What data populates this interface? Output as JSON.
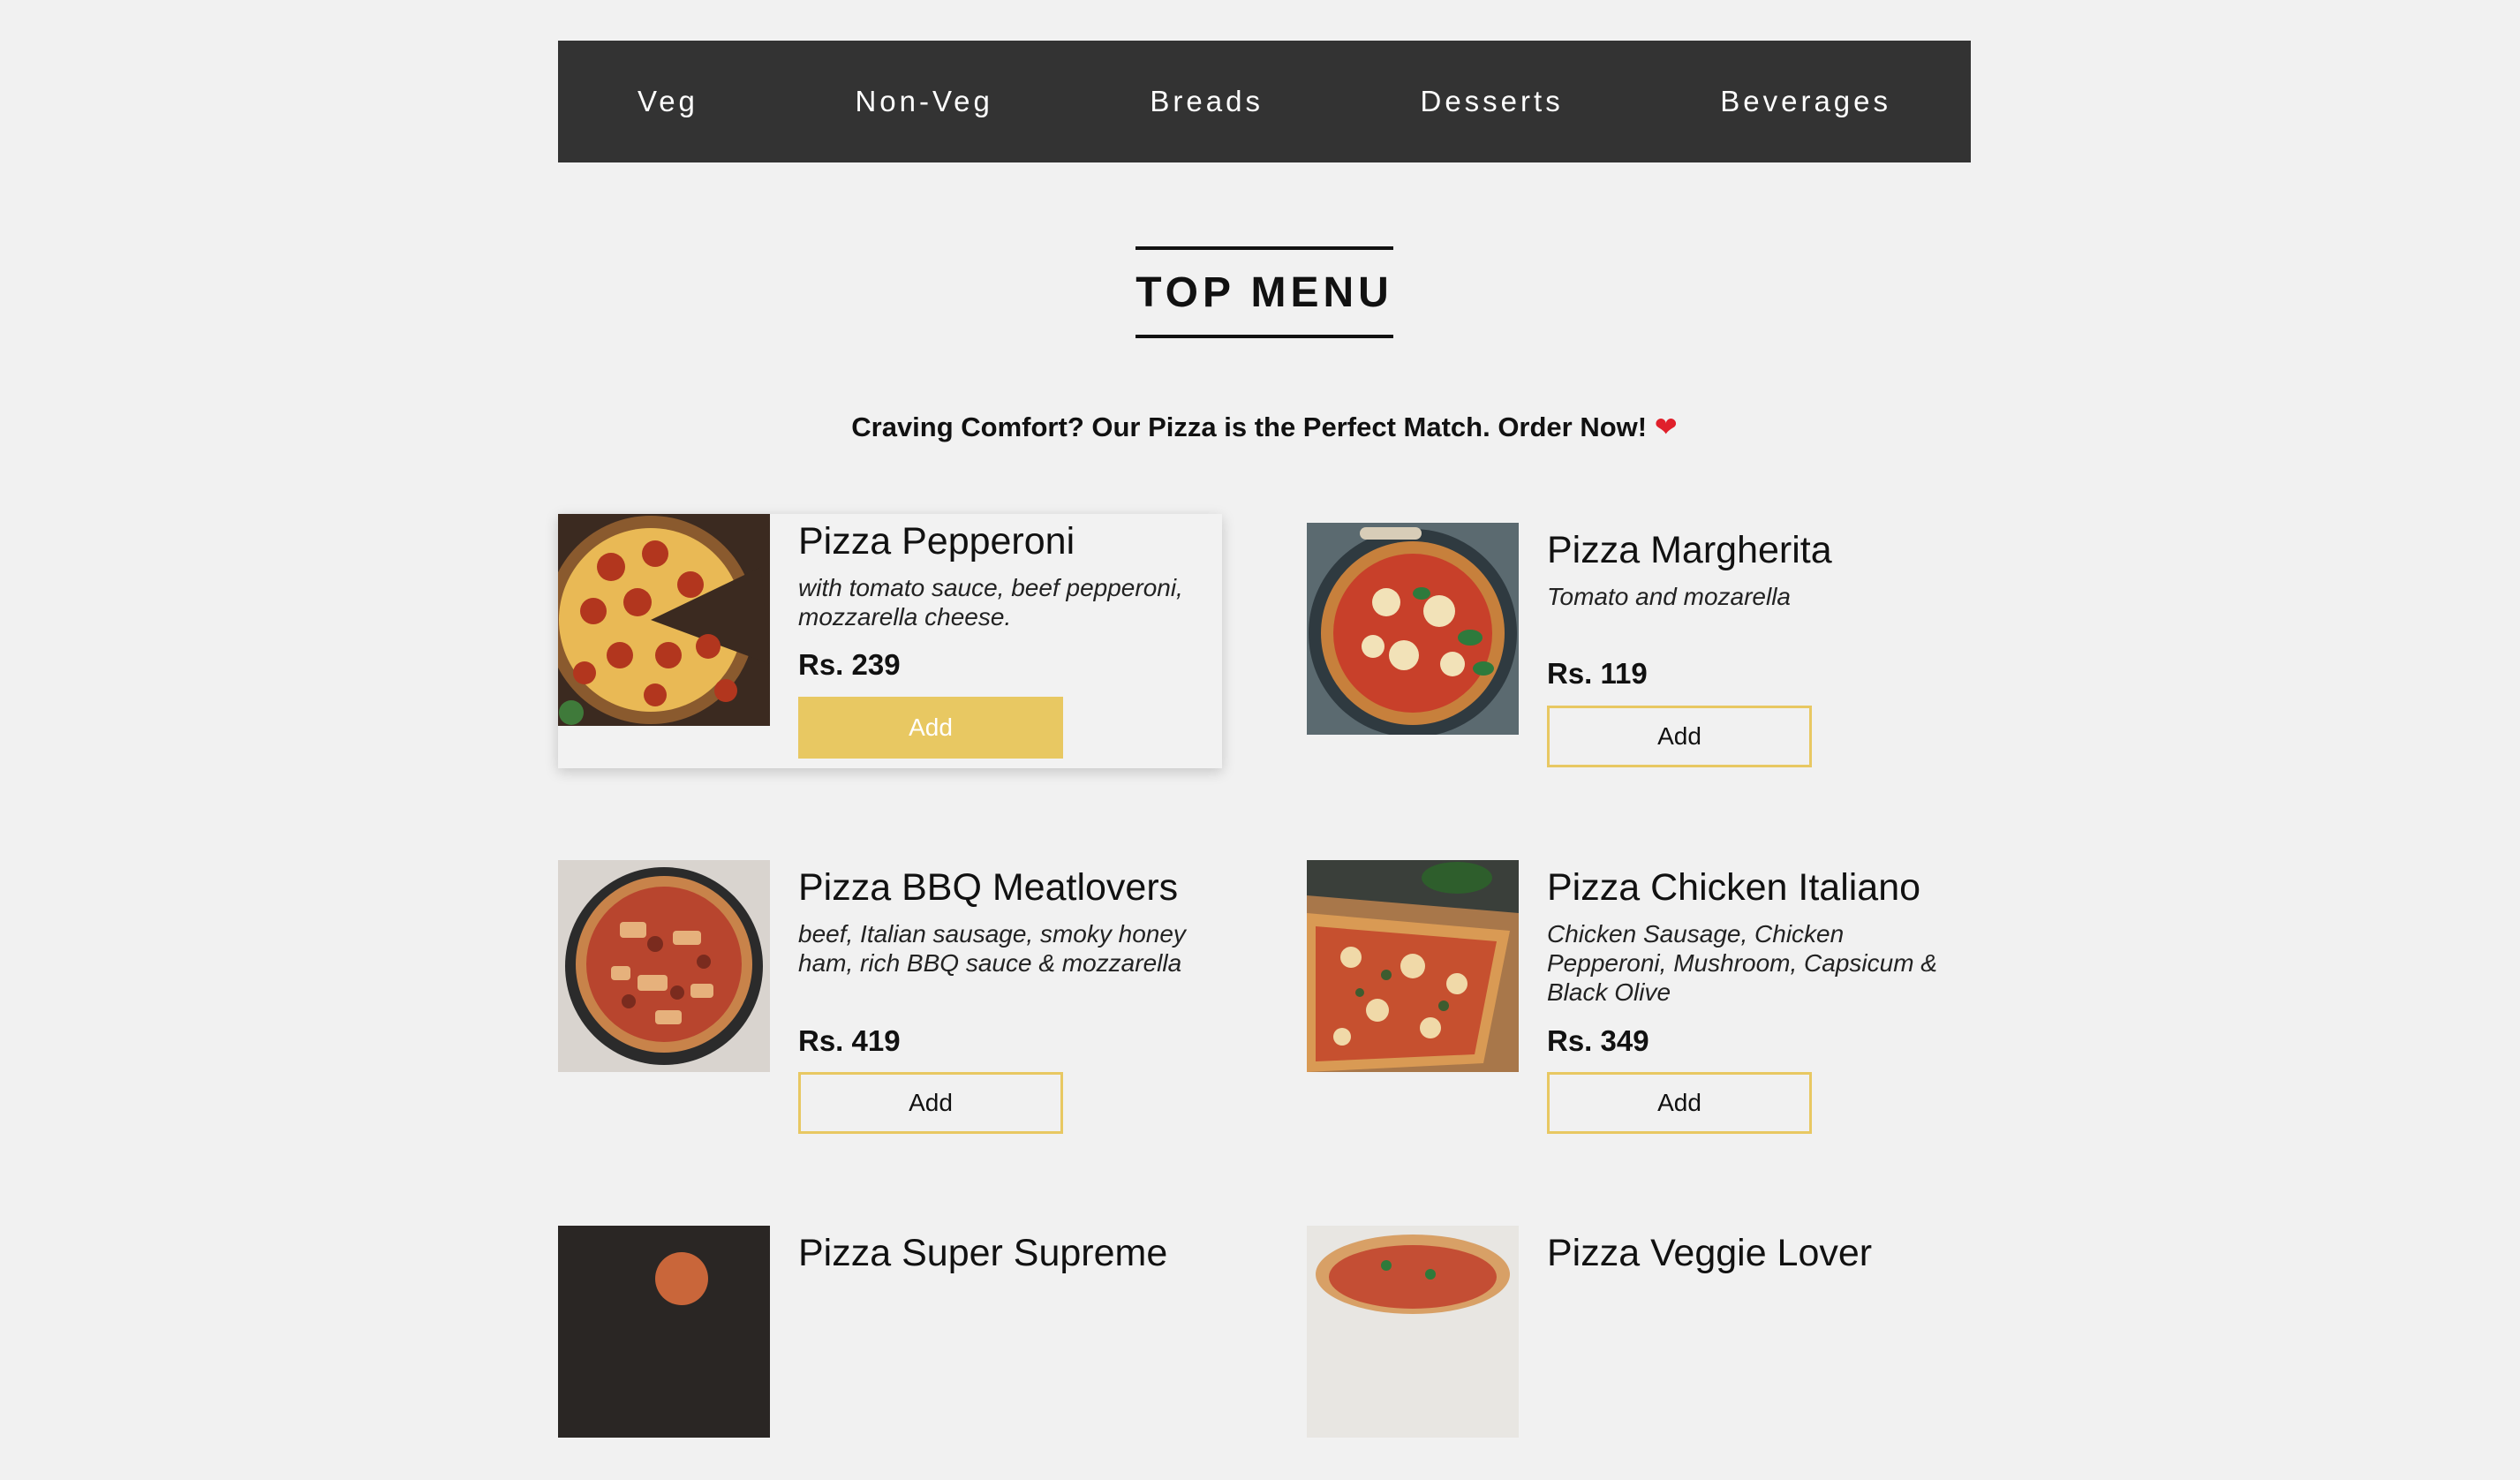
{
  "nav": {
    "items": [
      "Veg",
      "Non-Veg",
      "Breads",
      "Desserts",
      "Beverages"
    ]
  },
  "menu": {
    "title": "TOP MENU",
    "tagline": "Craving Comfort? Our Pizza is the Perfect Match. Order Now!",
    "tagline_icon": "heart-icon"
  },
  "items": [
    {
      "name": "Pizza Pepperoni",
      "desc": "with tomato sauce, beef pepperoni, mozzarella cheese.",
      "price": "Rs. 239",
      "button": "Add"
    },
    {
      "name": "Pizza Margherita",
      "desc": "Tomato and mozarella",
      "price": "Rs. 119",
      "button": "Add"
    },
    {
      "name": "Pizza BBQ Meatlovers",
      "desc": "beef, Italian sausage, smoky honey ham, rich BBQ sauce & mozzarella",
      "price": "Rs. 419",
      "button": "Add"
    },
    {
      "name": "Pizza Chicken Italiano",
      "desc": "Chicken Sausage, Chicken Pepperoni, Mushroom, Capsicum & Black Olive",
      "price": "Rs. 349",
      "button": "Add"
    },
    {
      "name": "Pizza Super Supreme",
      "desc": "",
      "price": "",
      "button": ""
    },
    {
      "name": "Pizza Veggie Lover",
      "desc": "",
      "price": "",
      "button": ""
    }
  ],
  "colors": {
    "nav_bg": "#333333",
    "accent": "#e8c862",
    "page_bg": "#f1f1f1"
  }
}
